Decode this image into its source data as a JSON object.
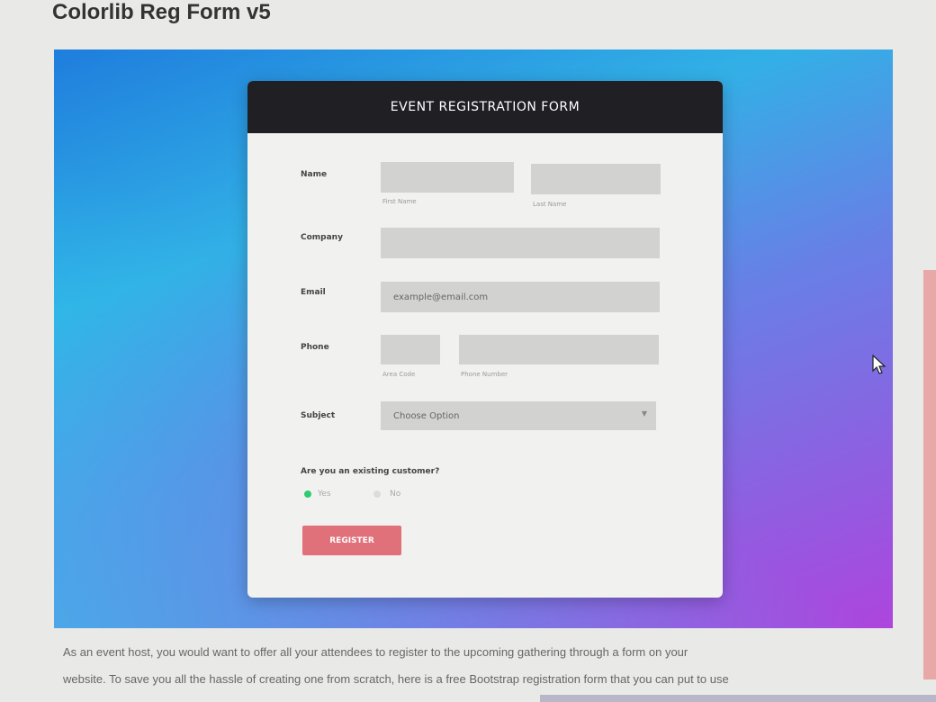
{
  "page": {
    "title": "Colorlib Reg Form v5",
    "description_line1": "As an event host, you would want to offer all your attendees to register to the upcoming gathering through a form on your",
    "description_line2": "website. To save you all the hassle of creating one from scratch, here is a free Bootstrap registration form that you can put to use"
  },
  "form": {
    "header": "EVENT REGISTRATION FORM",
    "name_label": "Name",
    "first_name_sub": "First Name",
    "last_name_sub": "Last Name",
    "company_label": "Company",
    "email_label": "Email",
    "email_placeholder": "example@email.com",
    "phone_label": "Phone",
    "area_code_sub": "Area Code",
    "phone_number_sub": "Phone Number",
    "subject_label": "Subject",
    "subject_selected": "Choose Option",
    "customer_question": "Are you an existing customer?",
    "yes_label": "Yes",
    "no_label": "No",
    "register_label": "REGISTER"
  },
  "colors": {
    "header_bg": "#1f1f24",
    "button_bg": "#e0707a",
    "radio_selected": "#2ecc71"
  },
  "icons": {
    "select_arrow": "chevron-down-icon",
    "cursor": "mouse-cursor-icon"
  }
}
